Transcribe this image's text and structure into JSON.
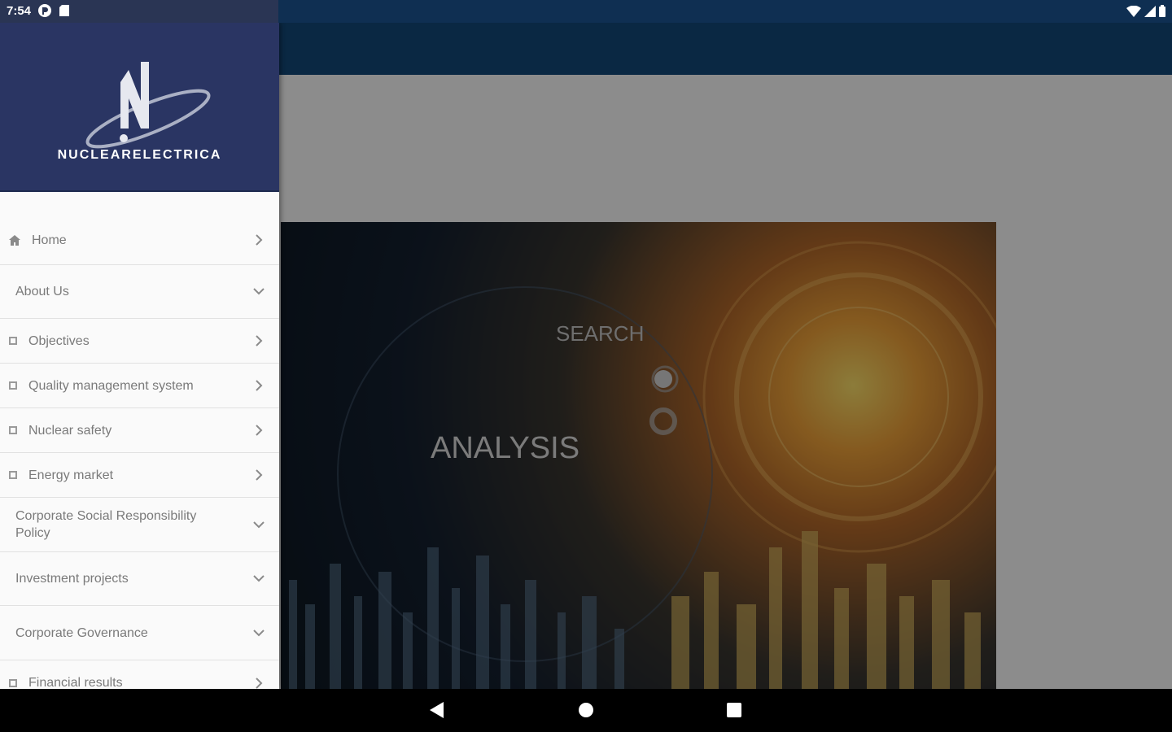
{
  "status_bar": {
    "time": "7:54"
  },
  "drawer": {
    "brand": "NUCLEARELECTRICA",
    "items": [
      {
        "label": "Home",
        "icon": "home-icon",
        "chevron": "right",
        "kind": "top"
      },
      {
        "label": "About Us",
        "icon": "",
        "chevron": "down",
        "kind": "sec"
      },
      {
        "label": "Objectives",
        "icon": "square-icon",
        "chevron": "right",
        "kind": "sub"
      },
      {
        "label": "Quality management system",
        "icon": "square-icon",
        "chevron": "right",
        "kind": "sub"
      },
      {
        "label": "Nuclear safety",
        "icon": "square-icon",
        "chevron": "right",
        "kind": "sub"
      },
      {
        "label": "Energy market",
        "icon": "square-icon",
        "chevron": "right",
        "kind": "sub"
      },
      {
        "label": "Corporate Social Responsibility Policy",
        "icon": "",
        "chevron": "down",
        "kind": "sec"
      },
      {
        "label": "Investment projects",
        "icon": "",
        "chevron": "down",
        "kind": "sec"
      },
      {
        "label": "Corporate Governance",
        "icon": "",
        "chevron": "down",
        "kind": "sec"
      },
      {
        "label": "Financial results",
        "icon": "square-icon",
        "chevron": "right",
        "kind": "sub"
      }
    ]
  },
  "hero": {
    "search_text": "SEARCH",
    "analysis_text": "ANALYSIS"
  },
  "colors": {
    "status_bar": "#0f2f52",
    "app_bar": "#134a7a",
    "drawer_header": "#2a3563"
  }
}
